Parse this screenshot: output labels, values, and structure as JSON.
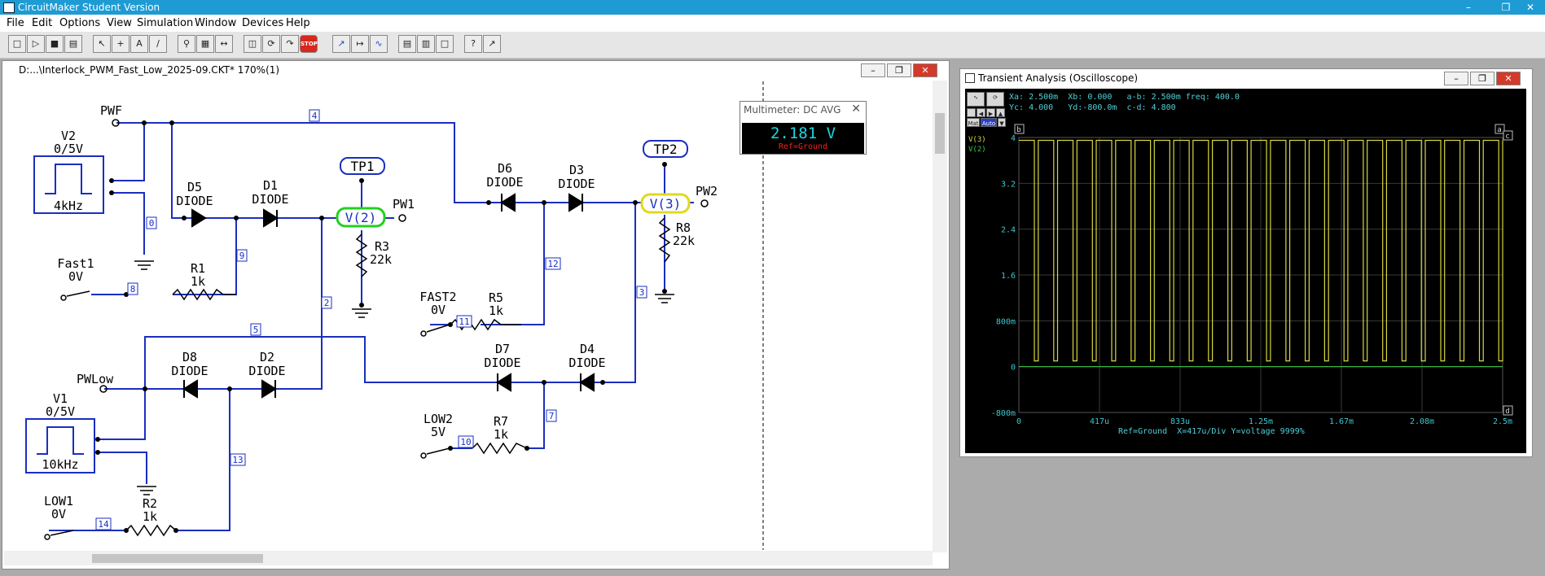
{
  "app": {
    "title": "CircuitMaker Student Version"
  },
  "menu": [
    "File",
    "Edit",
    "Options",
    "View",
    "Simulation",
    "Window",
    "Devices",
    "Help"
  ],
  "toolbar": {
    "stop_label": "STOP",
    "help_label": "?"
  },
  "schematic": {
    "title": "D:...\\Interlock_PWM_Fast_Low_2025-09.CKT* 170%(1)",
    "parts": {
      "v2": {
        "name": "V2",
        "value": "0/5V",
        "freq": "4kHz"
      },
      "v1": {
        "name": "V1",
        "value": "0/5V",
        "freq": "10kHz"
      },
      "d5": {
        "name": "D5",
        "type": "DIODE"
      },
      "d1": {
        "name": "D1",
        "type": "DIODE"
      },
      "d6": {
        "name": "D6",
        "type": "DIODE"
      },
      "d3": {
        "name": "D3",
        "type": "DIODE"
      },
      "d8": {
        "name": "D8",
        "type": "DIODE"
      },
      "d2": {
        "name": "D2",
        "type": "DIODE"
      },
      "d7": {
        "name": "D7",
        "type": "DIODE"
      },
      "d4": {
        "name": "D4",
        "type": "DIODE"
      },
      "r1": {
        "name": "R1",
        "value": "1k"
      },
      "r2": {
        "name": "R2",
        "value": "1k"
      },
      "r3": {
        "name": "R3",
        "value": "22k"
      },
      "r5": {
        "name": "R5",
        "value": "1k"
      },
      "r7": {
        "name": "R7",
        "value": "1k"
      },
      "r8": {
        "name": "R8",
        "value": "22k"
      },
      "tp1": "TP1",
      "tp2": "TP2",
      "probe_v2": "V(2)",
      "probe_v3": "V(3)",
      "pwf": "PWF",
      "pwlow": "PWLow",
      "pw1": "PW1",
      "pw2": "PW2",
      "fast1": {
        "name": "Fast1",
        "value": "0V"
      },
      "fast2": {
        "name": "FAST2",
        "value": "0V"
      },
      "low1": {
        "name": "LOW1",
        "value": "0V"
      },
      "low2": {
        "name": "LOW2",
        "value": "5V"
      }
    },
    "nodes": {
      "n0": "0",
      "n2": "2",
      "n3": "3",
      "n4": "4",
      "n5": "5",
      "n7": "7",
      "n8": "8",
      "n9": "9",
      "n10": "10",
      "n11": "11",
      "n12": "12",
      "n13": "13",
      "n14": "14"
    }
  },
  "multimeter": {
    "title": "Multimeter: DC AVG",
    "value": "2.181  V",
    "ref": "Ref=Ground"
  },
  "oscilloscope": {
    "title": "Transient Analysis (Oscilloscope)",
    "status_line1": "Xa: 2.500m  Xb: 0.000   a-b: 2.500m freq: 400.0",
    "status_line2": "Yc: 4.000   Yd:-800.0m  c-d: 4.800",
    "auto_label": "Auto",
    "mat_label": "Mat",
    "cursor_a": "a",
    "cursor_b": "b",
    "cursor_c": "c",
    "cursor_d": "d",
    "footer": "Ref=Ground  X=417u/Div Y=voltage 9999%",
    "colors": {
      "trace_v3": "#d8d840",
      "trace_v2": "#3fc84a",
      "grid": "#3a3a3a",
      "axis_text": "#3fc8d0"
    }
  },
  "chart_data": {
    "type": "line",
    "title": "",
    "xlabel": "",
    "ylabel": "",
    "xlim": [
      0,
      0.0025
    ],
    "ylim": [
      -0.8,
      4.0
    ],
    "x_tick_labels": [
      "0",
      "417u",
      "833u",
      "1.25m",
      "1.67m",
      "2.08m",
      "2.5m"
    ],
    "y_tick_labels": [
      "4",
      "3.2",
      "2.4",
      "1.6",
      "800m",
      "0",
      "-800m"
    ],
    "y_tick_values": [
      4.0,
      3.2,
      2.4,
      1.6,
      0.8,
      0.0,
      -0.8
    ],
    "grid": true,
    "series": [
      {
        "name": "V(3)",
        "color": "#d8d840",
        "waveform": "pulse",
        "high": 3.95,
        "low": 0.1,
        "period": 0.0001,
        "duty": 0.8
      },
      {
        "name": "V(2)",
        "color": "#3fc84a",
        "waveform": "constant",
        "level": 0.0
      }
    ]
  }
}
